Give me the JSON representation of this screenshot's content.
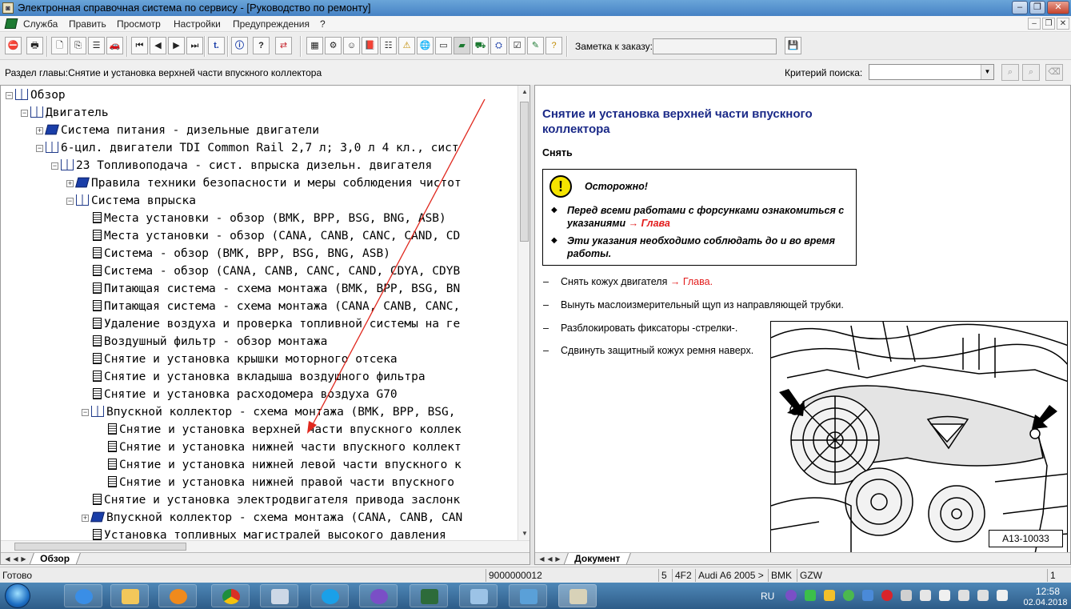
{
  "window": {
    "title": "Электронная справочная система по сервису - [Руководство по ремонту]"
  },
  "menu": {
    "items": [
      "Служба",
      "Править",
      "Просмотр",
      "Настройки",
      "Предупреждения",
      "?"
    ]
  },
  "toolbar": {
    "order_note_label": "Заметка к заказу:",
    "order_note_value": ""
  },
  "section_bar": {
    "section_label": "Раздел главы:Снятие и установка верхней части впускного коллектора",
    "search_criteria_label": "Критерий  поиска:",
    "search_criteria_value": ""
  },
  "tree": {
    "items": [
      {
        "label": "Обзор",
        "level": 0,
        "expander": "-",
        "icon": "book-open"
      },
      {
        "label": "Двигатель",
        "level": 1,
        "expander": "-",
        "icon": "book-open"
      },
      {
        "label": "Система питания - дизельные двигатели",
        "level": 2,
        "expander": "+",
        "icon": "book-closed"
      },
      {
        "label": "6-цил. двигатели TDI Common Rail 2,7 л; 3,0 л 4 кл., сист",
        "level": 2,
        "expander": "-",
        "icon": "book-open"
      },
      {
        "label": "23 Топливоподача - сист. впрыска дизельн. двигателя",
        "level": 3,
        "expander": "-",
        "icon": "book-open"
      },
      {
        "label": "Правила техники безопасности и меры соблюдения чистот",
        "level": 4,
        "expander": "+",
        "icon": "book-closed"
      },
      {
        "label": "Система впрыска",
        "level": 4,
        "expander": "-",
        "icon": "book-open"
      },
      {
        "label": "Места установки - обзор (BMK, BPP, BSG, BNG, ASB)",
        "level": 5,
        "expander": "",
        "icon": "page"
      },
      {
        "label": "Места установки - обзор (CANA, CANB, CANC, CAND, CD",
        "level": 5,
        "expander": "",
        "icon": "page"
      },
      {
        "label": "Система - обзор (BMK, BPP, BSG, BNG, ASB)",
        "level": 5,
        "expander": "",
        "icon": "page"
      },
      {
        "label": "Система - обзор (CANA, CANB, CANC, CAND, CDYA, CDYB",
        "level": 5,
        "expander": "",
        "icon": "page"
      },
      {
        "label": "Питающая система - схема монтажа (BMK, BPP, BSG, BN",
        "level": 5,
        "expander": "",
        "icon": "page"
      },
      {
        "label": "Питающая система - схема монтажа (CANA, CANB, CANC,",
        "level": 5,
        "expander": "",
        "icon": "page"
      },
      {
        "label": "Удаление воздуха и проверка топливной системы на ге",
        "level": 5,
        "expander": "",
        "icon": "page"
      },
      {
        "label": "Воздушный фильтр - обзор монтажа",
        "level": 5,
        "expander": "",
        "icon": "page"
      },
      {
        "label": "Снятие и установка крышки моторного отсека",
        "level": 5,
        "expander": "",
        "icon": "page"
      },
      {
        "label": "Снятие и установка вкладыша воздушного фильтра",
        "level": 5,
        "expander": "",
        "icon": "page"
      },
      {
        "label": "Снятие и установка расходомера воздуха G70",
        "level": 5,
        "expander": "",
        "icon": "page"
      },
      {
        "label": "Впускной коллектор - схема монтажа (BMK, BPP, BSG,",
        "level": 5,
        "expander": "-",
        "icon": "book-open"
      },
      {
        "label": "Снятие и установка верхней части впускного коллек",
        "level": 6,
        "expander": "",
        "icon": "page"
      },
      {
        "label": "Снятие и установка нижней части впускного коллект",
        "level": 6,
        "expander": "",
        "icon": "page"
      },
      {
        "label": "Снятие и установка нижней левой части впускного к",
        "level": 6,
        "expander": "",
        "icon": "page"
      },
      {
        "label": "Снятие и установка нижней правой части впускного",
        "level": 6,
        "expander": "",
        "icon": "page"
      },
      {
        "label": "Снятие и установка электродвигателя привода заслонк",
        "level": 5,
        "expander": "",
        "icon": "page"
      },
      {
        "label": "Впускной коллектор - схема монтажа (CANA, CANB, CAN",
        "level": 5,
        "expander": "+",
        "icon": "book-closed"
      },
      {
        "label": "Установка топливных магистралей высокого давления",
        "level": 5,
        "expander": "",
        "icon": "page"
      }
    ]
  },
  "left_tabs": {
    "active": "Обзор"
  },
  "document": {
    "title": "Снятие и установка верхней части впускного коллектора",
    "subtitle": "Снять",
    "warning": {
      "title": "Осторожно!",
      "items": [
        {
          "text": "Перед всеми работами с форсунками ознакомиться с указаниями ",
          "link": "→ Глава"
        },
        {
          "text": "Эти указания необходимо соблюдать до и во время работы.",
          "link": ""
        }
      ]
    },
    "steps": [
      {
        "text": "Снять кожух двигателя ",
        "link": "→ Глава."
      },
      {
        "text": "Вынуть маслоизмерительный щуп из направляющей трубки.",
        "link": ""
      },
      {
        "text": "Разблокировать фиксаторы -стрелки-.",
        "link": ""
      },
      {
        "text": "Сдвинуть защитный кожух ремня наверх.",
        "link": ""
      }
    ],
    "figure_label": "A13-10033",
    "tab": "Документ"
  },
  "status": {
    "ready": "Готово",
    "order_number": "9000000012",
    "c1": "5",
    "c2": "4F2",
    "model": "Audi A6 2005 >",
    "engine": "BMK",
    "gearbox": "GZW",
    "page": "1"
  },
  "taskbar": {
    "lang": "RU",
    "time": "12:58",
    "date": "02.04.2018"
  },
  "colors": {
    "doc_title": "#1b2a88",
    "link_red": "#e21b1b",
    "warning_yellow": "#f5e400"
  }
}
